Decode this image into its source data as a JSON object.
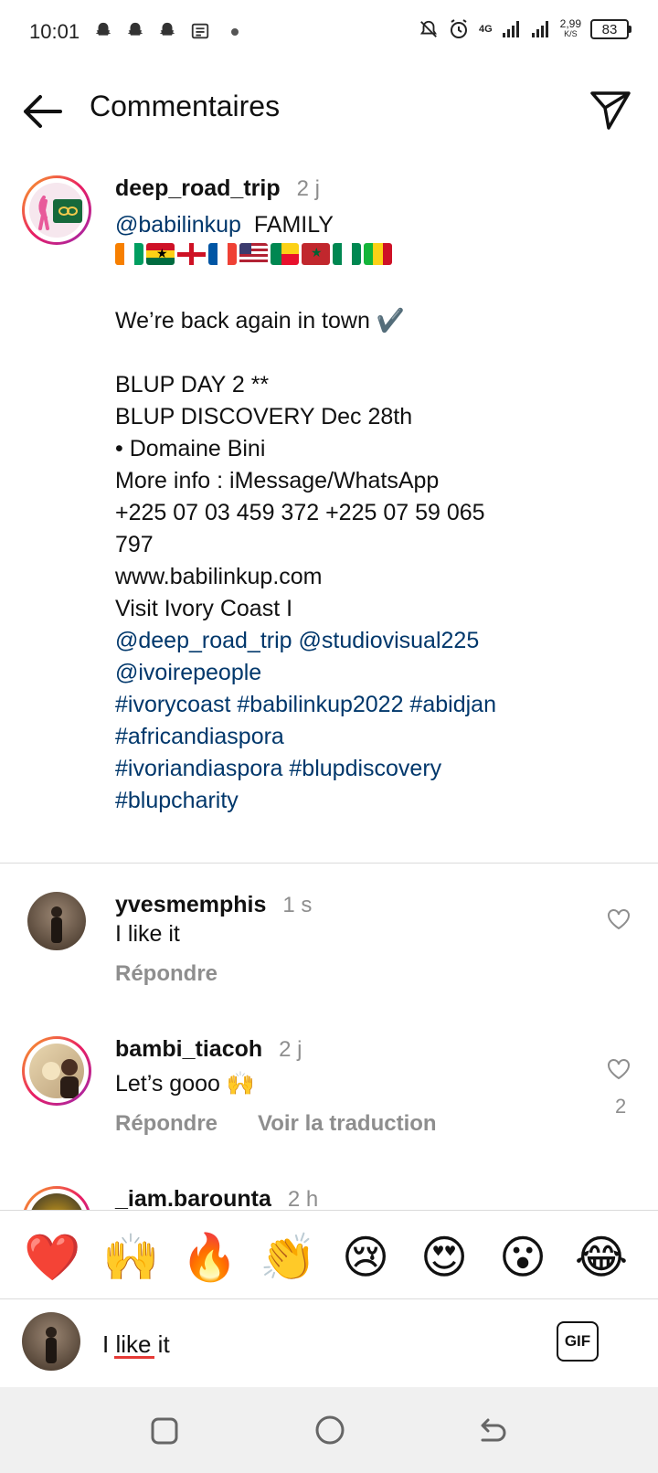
{
  "status_bar": {
    "time": "10:01",
    "network": "4G",
    "speed_value": "2,99",
    "speed_unit": "K/S",
    "battery": "83"
  },
  "header": {
    "title": "Commentaires",
    "back_icon": "arrow-left-icon",
    "share_icon": "paper-plane-icon"
  },
  "caption": {
    "username": "deep_road_trip",
    "time": "2 j",
    "mention": "@babilinkup",
    "family": "FAMILY",
    "line_back": "We’re back again in town ✔️",
    "line_day": "BLUP DAY 2 **",
    "line_discovery": "BLUP DISCOVERY Dec 28th",
    "line_domaine": "• Domaine Bini",
    "line_info": "More info : iMessage/WhatsApp",
    "line_phone": "+225 07 03 459 372 +225 07 59 065",
    "line_phone2": "797",
    "line_web": "www.babilinkup.com",
    "line_visit": "Visit Ivory Coast I",
    "line_mentions": "@deep_road_trip @studiovisual225",
    "line_mentions2": "@ivoirepeople",
    "line_tags1": "#ivorycoast #babilinkup2022 #abidjan",
    "line_tags2": "#africandiaspora",
    "line_tags3": "#ivoriandiaspora #blupdiscovery",
    "line_tags4": "#blupcharity"
  },
  "comments": [
    {
      "username": "yvesmemphis",
      "time": "1 s",
      "text": "I like it",
      "reply": "Répondre"
    },
    {
      "username": "bambi_tiacoh",
      "time": "2 j",
      "text": "Let’s gooo 🙌",
      "reply": "Répondre",
      "translate": "Voir la traduction",
      "likes": "2"
    },
    {
      "username": "_iam.barounta",
      "time": "2 h"
    }
  ],
  "emoji_bar": [
    "❤️",
    "🙌",
    "🔥",
    "👏",
    "😢",
    "😍",
    "😮",
    "😂"
  ],
  "input": {
    "value": "I like it",
    "gif_label": "GIF"
  },
  "colors": {
    "link": "#00376b",
    "secondary": "#8e8e8e",
    "divider": "#dbdbdb"
  }
}
